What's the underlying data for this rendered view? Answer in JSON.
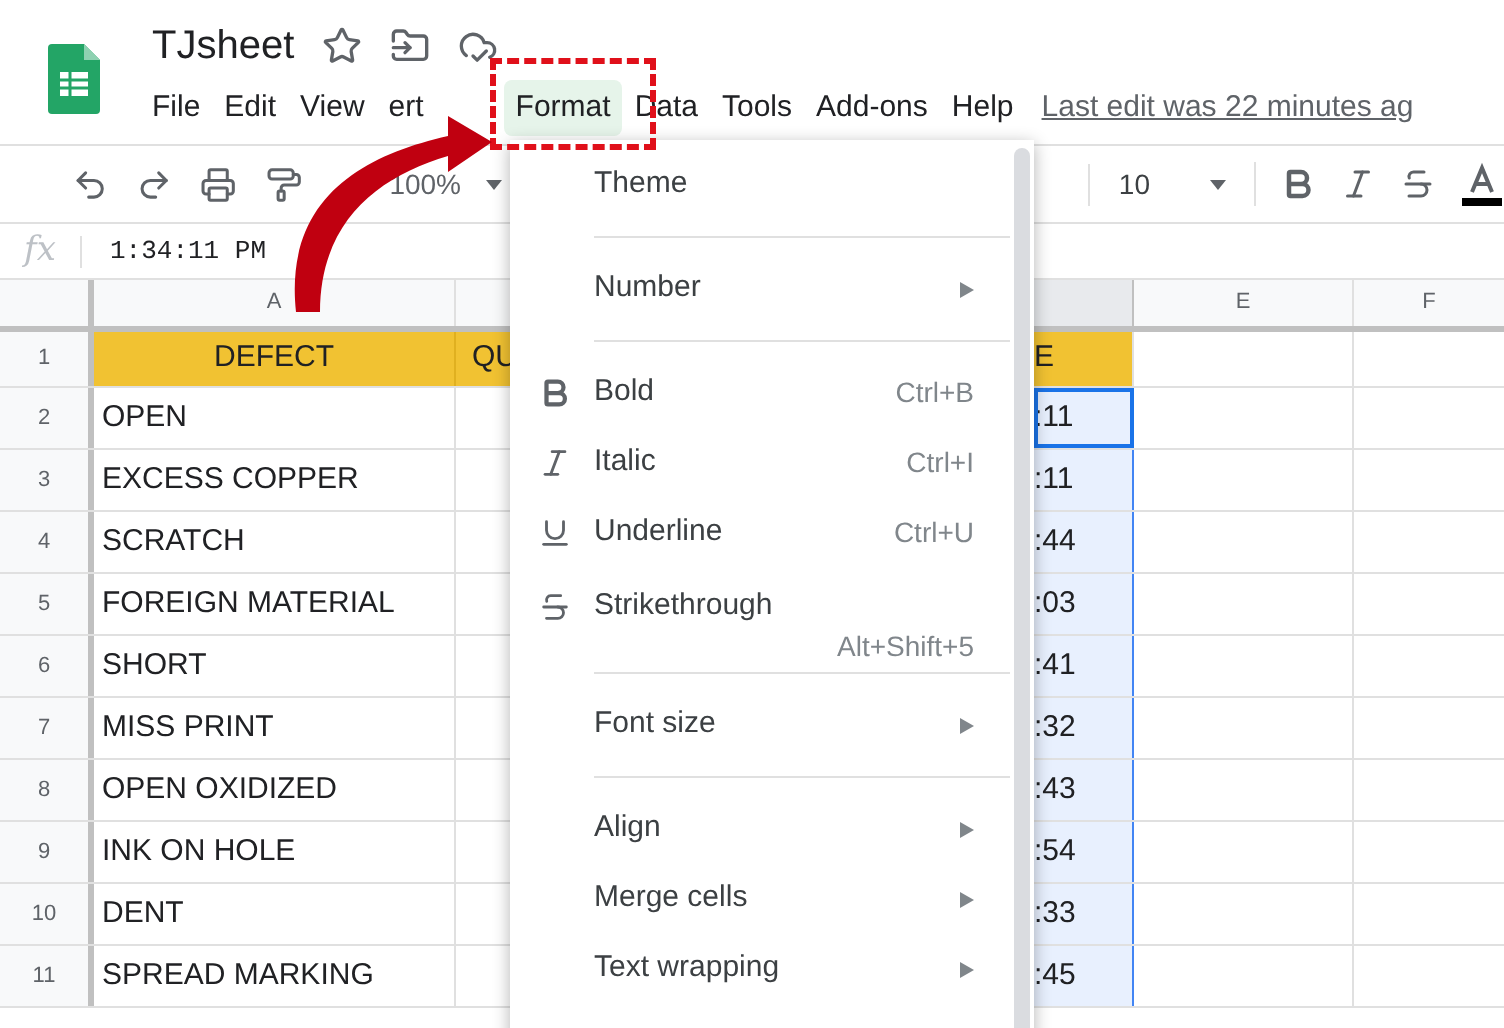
{
  "document": {
    "title": "TJsheet"
  },
  "menu_bar": [
    {
      "label": "File",
      "selected": false
    },
    {
      "label": "Edit",
      "selected": false
    },
    {
      "label": "View",
      "selected": false
    },
    {
      "label": "ert",
      "selected": false
    },
    {
      "label": "Format",
      "selected": true
    },
    {
      "label": "Data",
      "selected": false
    },
    {
      "label": "Tools",
      "selected": false
    },
    {
      "label": "Add-ons",
      "selected": false
    },
    {
      "label": "Help",
      "selected": false
    }
  ],
  "last_edit": "Last edit was 22 minutes ag",
  "toolbar": {
    "zoom": "100%",
    "font_size": "10"
  },
  "formula_bar": {
    "fx": "fx",
    "value": "1:34:11 PM"
  },
  "columns": [
    {
      "label": "A"
    },
    {
      "label": "E"
    },
    {
      "label": "F"
    }
  ],
  "header_row": {
    "number": "1",
    "defect": "DEFECT",
    "col_b": "QU",
    "col_d": "E"
  },
  "rows": [
    {
      "number": "2",
      "defect": "OPEN",
      "col_d": ":11",
      "selected": true,
      "active": true
    },
    {
      "number": "3",
      "defect": "EXCESS COPPER",
      "col_d": ":11",
      "selected": true,
      "active": false
    },
    {
      "number": "4",
      "defect": "SCRATCH",
      "col_d": ":44",
      "selected": true,
      "active": false
    },
    {
      "number": "5",
      "defect": "FOREIGN MATERIAL",
      "col_d": ":03",
      "selected": true,
      "active": false
    },
    {
      "number": "6",
      "defect": "SHORT",
      "col_d": ":41",
      "selected": true,
      "active": false
    },
    {
      "number": "7",
      "defect": "MISS PRINT",
      "col_d": ":32",
      "selected": true,
      "active": false
    },
    {
      "number": "8",
      "defect": "OPEN OXIDIZED",
      "col_d": ":43",
      "selected": true,
      "active": false
    },
    {
      "number": "9",
      "defect": "INK ON HOLE",
      "col_d": ":54",
      "selected": true,
      "active": false
    },
    {
      "number": "10",
      "defect": "DENT",
      "col_d": ":33",
      "selected": true,
      "active": false
    },
    {
      "number": "11",
      "defect": "SPREAD MARKING",
      "col_d": ":45",
      "selected": true,
      "active": false
    }
  ],
  "format_menu": [
    {
      "kind": "item",
      "label": "Theme"
    },
    {
      "kind": "separator"
    },
    {
      "kind": "item",
      "label": "Number",
      "submenu": true
    },
    {
      "kind": "separator"
    },
    {
      "kind": "bold",
      "label": "Bold",
      "shortcut": "Ctrl+B"
    },
    {
      "kind": "italic",
      "label": "Italic",
      "shortcut": "Ctrl+I"
    },
    {
      "kind": "underline",
      "label": "Underline",
      "shortcut": "Ctrl+U"
    },
    {
      "kind": "strike",
      "label": "Strikethrough",
      "shortcut": "Alt+Shift+5"
    },
    {
      "kind": "separator"
    },
    {
      "kind": "item",
      "label": "Font size",
      "submenu": true
    },
    {
      "kind": "separator"
    },
    {
      "kind": "item",
      "label": "Align",
      "submenu": true
    },
    {
      "kind": "item",
      "label": "Merge cells",
      "submenu": true
    },
    {
      "kind": "item",
      "label": "Text wrapping",
      "submenu": true
    }
  ]
}
